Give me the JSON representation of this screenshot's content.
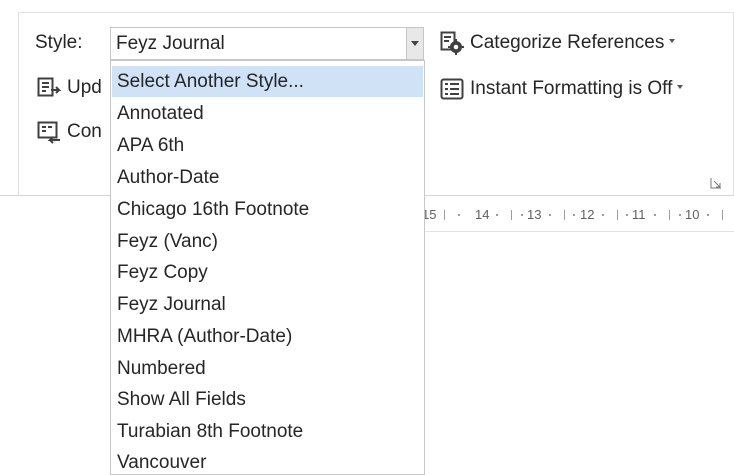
{
  "toolbar": {
    "style_label": "Style:",
    "style_value": "Feyz Journal",
    "update_label": "Upd",
    "convert_label": "Con",
    "categorize_label": "Categorize References",
    "instant_label": "Instant Formatting is Off"
  },
  "dropdown": {
    "items": [
      "Select Another Style...",
      "Annotated",
      "APA 6th",
      "Author-Date",
      "Chicago 16th Footnote",
      "Feyz (Vanc)",
      "Feyz Copy",
      "Feyz Journal",
      "MHRA (Author-Date)",
      "Numbered",
      "Show All Fields",
      "Turabian 8th Footnote",
      "Vancouver"
    ],
    "highlighted_index": 0
  },
  "ruler": {
    "labels": [
      "15",
      "14",
      "13",
      "12",
      "11",
      "10"
    ]
  },
  "icons": {
    "update": "update-citations-icon",
    "convert": "convert-citations-icon",
    "categorize": "categorize-gear-icon",
    "instant": "instant-formatting-icon",
    "launcher": "dialog-launcher-icon"
  },
  "colors": {
    "highlight": "#cfe2f6",
    "border": "#c6c6c6",
    "text": "#262626"
  }
}
